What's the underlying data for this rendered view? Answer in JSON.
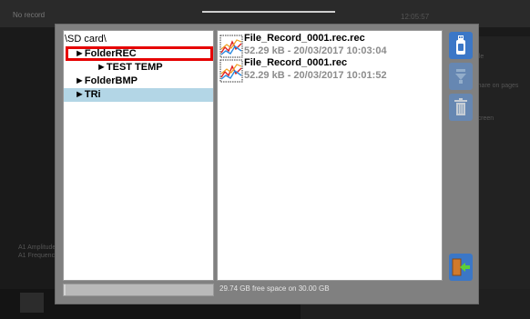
{
  "background": {
    "status_text": "No record",
    "clock_text": "12:05:57",
    "right_buttons": [
      "File",
      "Share on pages",
      "Screen"
    ],
    "left_labels": [
      "A1 Amplitude",
      "A1 Frequency"
    ]
  },
  "tree": {
    "root_label": "\\SD card\\",
    "items": [
      {
        "label": "►FolderREC",
        "selected": true
      },
      {
        "label": "►TEST TEMP",
        "selected": false
      },
      {
        "label": "►FolderBMP",
        "selected": false
      },
      {
        "label": "►TRi",
        "selected": true
      }
    ]
  },
  "files": [
    {
      "name": "File_Record_0001.rec.rec",
      "meta": "52.29 kB - 20/03/2017 10:03:04",
      "icon": "chart-file-icon"
    },
    {
      "name": "File_Record_0001.rec",
      "meta": "52.29 kB - 20/03/2017 10:01:52",
      "icon": "chart-file-icon"
    }
  ],
  "side_buttons": [
    {
      "name": "usb-button",
      "icon": "usb-drive-icon"
    },
    {
      "name": "export-button",
      "icon": "export-arrow-icon"
    },
    {
      "name": "delete-button",
      "icon": "trash-icon"
    },
    {
      "name": "exit-button",
      "icon": "exit-door-icon"
    }
  ],
  "storage": {
    "free_space_text": "29.74 GB free space on 30.00 GB",
    "used_fraction": 0.01
  },
  "colors": {
    "accent": "#3b77c7",
    "selection": "#b3d6e6",
    "highlight": "#e60000"
  }
}
